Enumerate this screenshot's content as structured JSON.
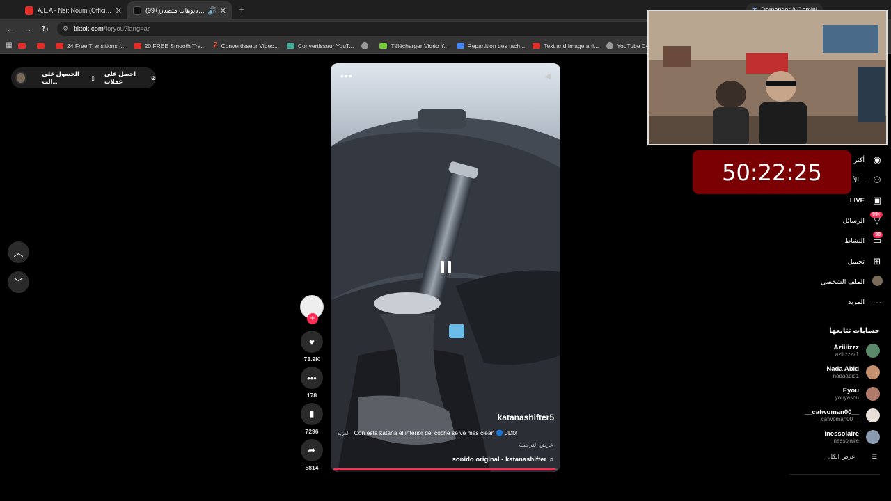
{
  "browser": {
    "tabs": [
      {
        "title": "A.L.A - Nsit Noum (Official Mus",
        "active": false,
        "favicon": "youtube-icon"
      },
      {
        "title": "(99+)شاهد فيديوهات متصدر",
        "active": true,
        "favicon": "tiktok-icon"
      }
    ],
    "new_tab": "+",
    "gemini_label": "Demander à Gemini",
    "address": {
      "host": "tiktok.com",
      "path": "/foryou?lang=ar"
    },
    "bookmarks": [
      {
        "label": "",
        "icon": "youtube-icon"
      },
      {
        "label": "",
        "icon": "youtube-icon"
      },
      {
        "label": "24 Free Transitions f...",
        "icon": "youtube-icon"
      },
      {
        "label": "20 FREE Smooth Tra...",
        "icon": "youtube-icon"
      },
      {
        "label": "Convertisseur Video...",
        "icon": "z-icon"
      },
      {
        "label": "Convertisseur YouT...",
        "icon": "converter-icon"
      },
      {
        "label": "",
        "icon": "globe-icon"
      },
      {
        "label": "Télécharger Vidéo Y...",
        "icon": "download-icon"
      },
      {
        "label": "Repartition des tach...",
        "icon": "docs-icon"
      },
      {
        "label": "Text and Image ani...",
        "icon": "youtube-icon"
      },
      {
        "label": "YouTube Converter...",
        "icon": "globe-icon"
      }
    ]
  },
  "top_bar": {
    "get_app": "الحصول على الت...",
    "get_coins": "احصل على عملات"
  },
  "video": {
    "author": "katanashifter5",
    "description": "Con esta katana el interior del coche se ve mas clean 🔵 JDM",
    "more": "المزيد",
    "translate": "عرض الترجمة",
    "sound": "sonido original - katanashifter",
    "progress": 0.99
  },
  "actions": {
    "likes": "73.9K",
    "comments": "178",
    "saves": "7296",
    "shares": "5814"
  },
  "sidebar": {
    "nav": [
      {
        "label": "أكثر",
        "icon": "home-icon"
      },
      {
        "label": "الأ...",
        "icon": "friends-icon"
      },
      {
        "label": "LIVE",
        "icon": "live-icon"
      },
      {
        "label": "الرسائل",
        "icon": "inbox-icon",
        "badge": "99+"
      },
      {
        "label": "النشاط",
        "icon": "activity-icon",
        "badge": "98"
      },
      {
        "label": "تحميل",
        "icon": "upload-icon"
      },
      {
        "label": "الملف الشخصي",
        "icon": "profile-icon"
      },
      {
        "label": "المزيد",
        "icon": "more-icon"
      }
    ],
    "following_title": "حسابات تتابعها",
    "accounts": [
      {
        "name": "Aziiiizzz",
        "handle": "aziiizzzz1",
        "color": "#5a8a6a"
      },
      {
        "name": "Nada Abid",
        "handle": "nadaabid1",
        "color": "#c49070"
      },
      {
        "name": "Eyou",
        "handle": "youyasou",
        "color": "#b07a6a"
      },
      {
        "name": "__catwoman00__",
        "handle": "__catwoman00__",
        "color": "#e8e0d8"
      },
      {
        "name": "inessolaire",
        "handle": "inessolaire",
        "color": "#8a9ab0"
      }
    ],
    "see_all": "عرض الكل"
  },
  "overlay": {
    "timer": "50:22:25"
  },
  "colors": {
    "accent": "#fe2c55",
    "timer_bg": "#7a0003"
  }
}
